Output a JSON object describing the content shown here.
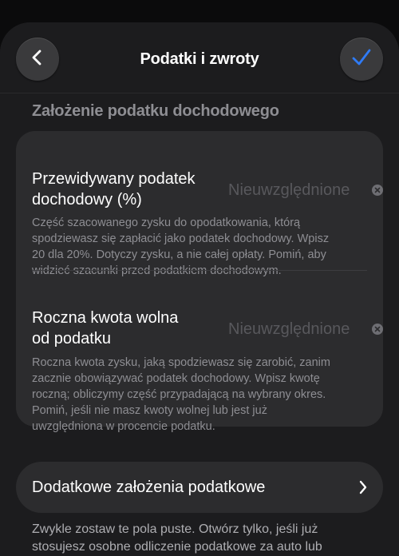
{
  "nav": {
    "title": "Podatki i zwroty",
    "back_icon": "chevron-left-icon",
    "confirm_icon": "checkmark-icon",
    "accent_color": "#2f7bf6"
  },
  "section": {
    "title": "Założenie podatku dochodowego"
  },
  "fields": [
    {
      "label_line1": "Przewidywany podatek",
      "label_line2": "dochodowy (%)",
      "value": "Nieuwzględnione",
      "description_lines": [
        "Część szacowanego zysku do opodatkowania, którą",
        "spodziewasz się zapłacić jako podatek dochodowy. Wpisz",
        "20 dla 20%. Dotyczy zysku, a nie całej opłaty. Pomiń, aby",
        "widzieć szacunki przed podatkiem dochodowym."
      ]
    },
    {
      "label_line1": "Roczna kwota wolna",
      "label_line2": "od podatku",
      "value": "Nieuwzględnione",
      "description_lines": [
        "Roczna kwota zysku, jaką spodziewasz się zarobić, zanim",
        "zacznie obowiązywać podatek dochodowy. Wpisz kwotę",
        "roczną; obliczymy część przypadającą na wybrany okres.",
        "Pomiń, jeśli nie masz kwoty wolnej lub jest już",
        "uwzględniona w procencie podatku."
      ]
    }
  ],
  "more": {
    "label": "Dodatkowe założenia podatkowe",
    "icon": "chevron-right-icon"
  },
  "footer": {
    "line1": "Zwykle zostaw te pola puste. Otwórz tylko, jeśli już",
    "line2": "stosujesz osobne odliczenie podatkowe za auto lub"
  }
}
